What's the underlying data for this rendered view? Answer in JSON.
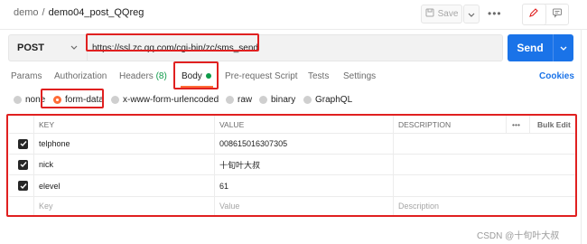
{
  "breadcrumb": {
    "parent": "demo",
    "separator": "/",
    "current": "demo04_post_QQreg"
  },
  "toolbar": {
    "save_label": "Save",
    "more_label": "•••"
  },
  "request": {
    "method": "POST",
    "url": "https://ssl.zc.qq.com/cgi-bin/zc/sms_send",
    "send_label": "Send"
  },
  "tabs": [
    {
      "label": "Params"
    },
    {
      "label": "Authorization"
    },
    {
      "label": "Headers",
      "count": "(8)"
    },
    {
      "label": "Body",
      "active": true
    },
    {
      "label": "Pre-request Script"
    },
    {
      "label": "Tests"
    },
    {
      "label": "Settings"
    }
  ],
  "cookies_label": "Cookies",
  "body_types": [
    "none",
    "form-data",
    "x-www-form-urlencoded",
    "raw",
    "binary",
    "GraphQL"
  ],
  "table": {
    "headers": {
      "key": "KEY",
      "value": "VALUE",
      "description": "DESCRIPTION",
      "more": "•••",
      "bulk_edit": "Bulk Edit"
    },
    "rows": [
      {
        "key": "telphone",
        "value": "008615016307305",
        "description": ""
      },
      {
        "key": "nick",
        "value": "十旬叶大叔",
        "description": ""
      },
      {
        "key": "elevel",
        "value": "61",
        "description": ""
      }
    ],
    "placeholder": {
      "key": "Key",
      "value": "Value",
      "description": "Description"
    }
  },
  "watermark": "CSDN @十旬叶大叔",
  "colors": {
    "accent": "#ff6c37",
    "send": "#1a73e8",
    "annotation": "#e02020",
    "green": "#0e9a49"
  }
}
